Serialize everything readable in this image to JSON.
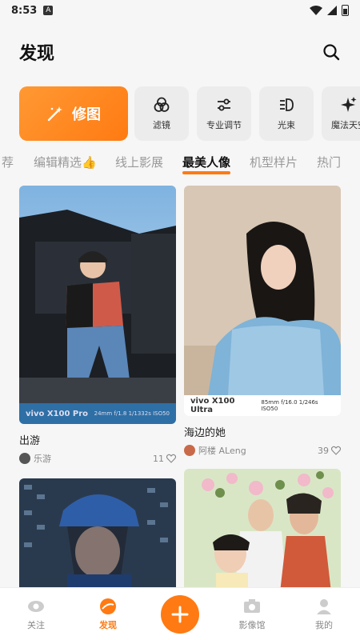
{
  "status": {
    "time": "8:53",
    "app_icon": "A"
  },
  "header": {
    "title": "发现"
  },
  "tools": {
    "main_label": "修图",
    "items": [
      {
        "label": "滤镜",
        "icon": "filter-icon"
      },
      {
        "label": "专业调节",
        "icon": "sliders-icon"
      },
      {
        "label": "光束",
        "icon": "beam-icon"
      },
      {
        "label": "魔法天空",
        "icon": "sparkle-icon"
      }
    ]
  },
  "tabs": [
    "荐",
    "编辑精选👍",
    "线上影展",
    "最美人像",
    "机型样片",
    "热门"
  ],
  "active_tab": "最美人像",
  "posts": [
    {
      "title": "出游",
      "author": "乐游",
      "likes": "11",
      "exif_brand": "vivo X100 Pro",
      "exif_spec": "24mm f/1.8 1/1332s ISO50"
    },
    {
      "title": "海边的她",
      "author": "阿楼 ALeng",
      "likes": "39",
      "exif_brand": "vivo X100 Ultra",
      "exif_spec": "85mm f/16.0 1/246s ISO50"
    },
    {
      "title": "",
      "author": "",
      "likes": ""
    },
    {
      "title": "",
      "author": "",
      "likes": ""
    }
  ],
  "tabbar": {
    "follow": "关注",
    "discover": "发现",
    "gallery": "影像馆",
    "mine": "我的"
  },
  "colors": {
    "accent": "#ff7a12"
  }
}
